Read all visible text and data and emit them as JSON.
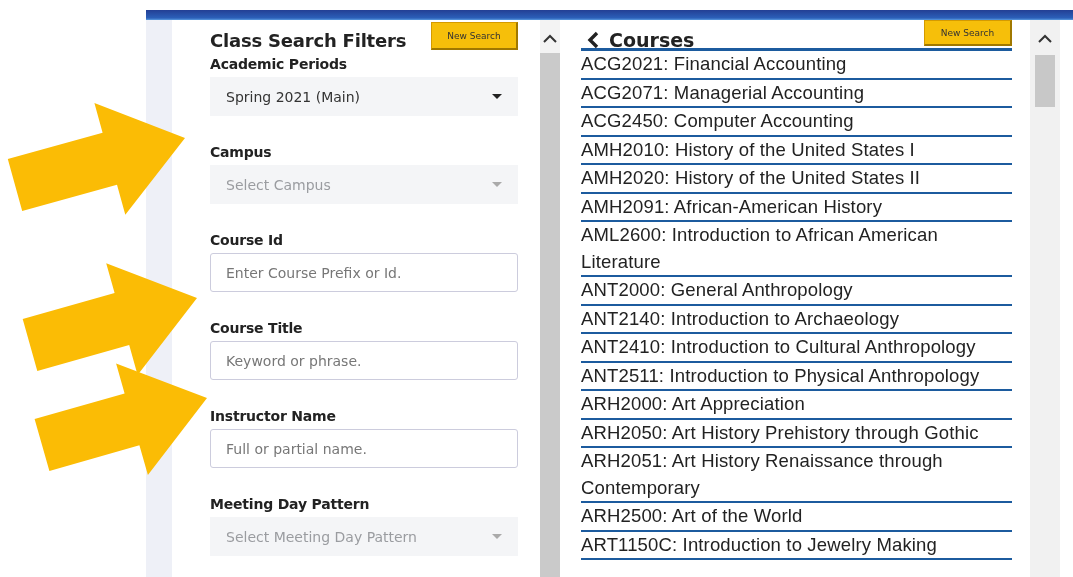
{
  "filters": {
    "title": "Class Search Filters",
    "new_search_button": "New Search",
    "fields": [
      {
        "kind": "select",
        "label": "Academic Periods",
        "value": "Spring 2021 (Main)"
      },
      {
        "kind": "select",
        "label": "Campus",
        "placeholder": "Select Campus"
      },
      {
        "kind": "input",
        "label": "Course Id",
        "placeholder": "Enter Course Prefix or Id."
      },
      {
        "kind": "input",
        "label": "Course Title",
        "placeholder": "Keyword or phrase."
      },
      {
        "kind": "input",
        "label": "Instructor Name",
        "placeholder": "Full or partial name."
      },
      {
        "kind": "select",
        "label": "Meeting Day Pattern",
        "placeholder": "Select Meeting Day Pattern"
      }
    ]
  },
  "courses": {
    "title": "Courses",
    "new_search_button": "New Search",
    "items": [
      "ACG2021: Financial Accounting",
      "ACG2071: Managerial Accounting",
      "ACG2450: Computer Accounting",
      "AMH2010: History of the United States I",
      "AMH2020: History of the United States II",
      "AMH2091: African-American History",
      "AML2600: Introduction to African American Literature",
      "ANT2000: General Anthropology",
      "ANT2140: Introduction to Archaeology",
      "ANT2410: Introduction to Cultural Anthropology",
      "ANT2511: Introduction to Physical Anthropology",
      "ARH2000: Art Appreciation",
      "ARH2050: Art History Prehistory through Gothic",
      "ARH2051: Art History Renaissance through Contemporary",
      "ARH2500: Art of the World",
      "ART1150C: Introduction to Jewelry Making"
    ]
  }
}
